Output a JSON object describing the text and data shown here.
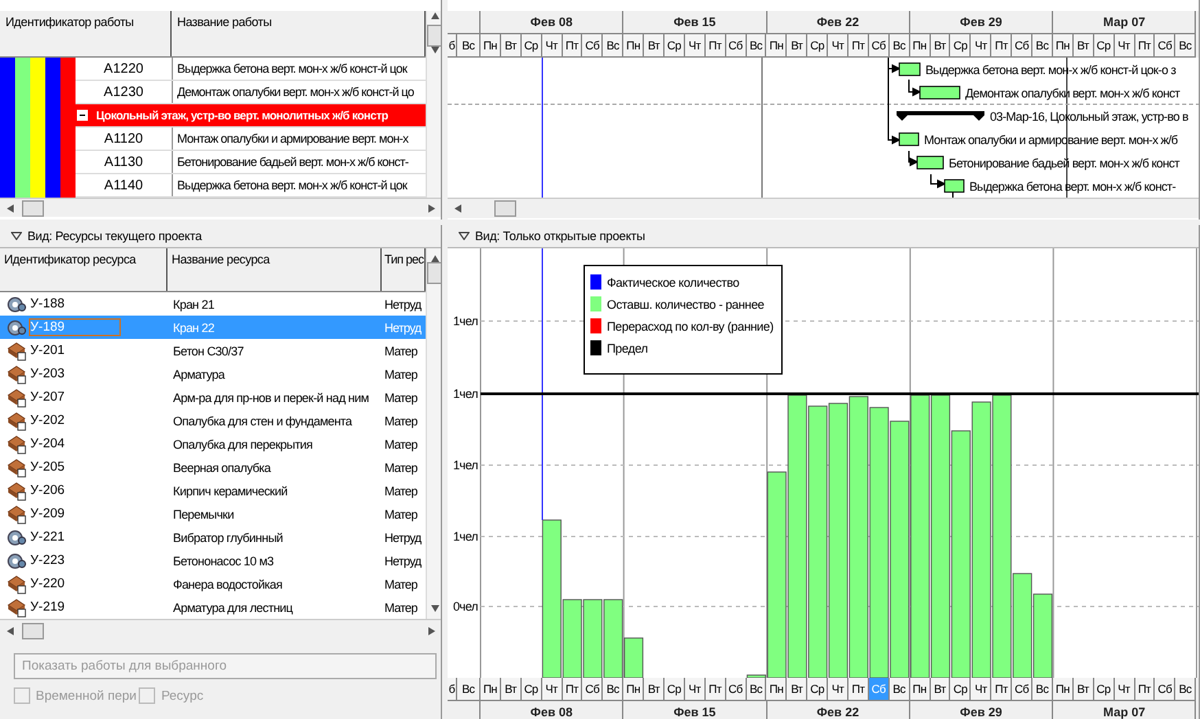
{
  "activities": {
    "columns": [
      "Идентификатор работы",
      "Название работы"
    ],
    "wbs_bands": [
      {
        "color": "#0000ff"
      },
      {
        "color": "#80ff80"
      },
      {
        "color": "#ffff00"
      },
      {
        "color": "#0000ff"
      },
      {
        "color": "#ff0000"
      }
    ],
    "rows": [
      {
        "kind": "activity",
        "id": "A1220",
        "name": "Выдержка бетона верт. мон-х ж/б конст-й цок"
      },
      {
        "kind": "activity",
        "id": "A1230",
        "name": "Демонтаж опалубки верт. мон-х ж/б конст-й цо"
      },
      {
        "kind": "wbs",
        "name": "Цокольный этаж, устр-во верт. монолитных ж/б констр",
        "expanded": true
      },
      {
        "kind": "activity",
        "id": "A1120",
        "name": "Монтаж опалубки и армирование верт. мон-х"
      },
      {
        "kind": "activity",
        "id": "A1130",
        "name": "Бетонирование бадьей верт. мон-х ж/б конст-"
      },
      {
        "kind": "activity",
        "id": "A1140",
        "name": "Выдержка бетона верт. мон-х ж/б конст-й цок"
      }
    ]
  },
  "gantt": {
    "months": [
      "Фев 08",
      "Фев 15",
      "Фев 22",
      "Фев 29",
      "Мар 07"
    ],
    "days": [
      "б",
      "Вс",
      "Пн",
      "Вт",
      "Ср",
      "Чт",
      "Пт",
      "Сб",
      "Вс",
      "Пн",
      "Вт",
      "Ср",
      "Чт",
      "Пт",
      "Сб",
      "Вс",
      "Пн",
      "Вт",
      "Ср",
      "Чт",
      "Пт",
      "Сб",
      "Вс",
      "Пн",
      "Вт",
      "Ср",
      "Чт",
      "Пт",
      "Сб",
      "Вс",
      "Пн",
      "Вт",
      "Ср",
      "Чт",
      "Пт",
      "Сб",
      "Вс"
    ],
    "bars": [
      {
        "kind": "activity",
        "label": "Выдержка бетона верт. мон-х ж/б конст-й цок-о з"
      },
      {
        "kind": "activity",
        "label": "Демонтаж опалубки верт. мон-х ж/б конст"
      },
      {
        "kind": "summary",
        "label": "03-Мар-16, Цокольный этаж, устр-во в"
      },
      {
        "kind": "activity",
        "label": "Монтаж опалубки и армирование верт. мон-х ж/б"
      },
      {
        "kind": "activity",
        "label": "Бетонирование бадьей верт. мон-х ж/б конст"
      },
      {
        "kind": "activity",
        "label": "Выдержка бетона верт. мон-х ж/б конст-"
      }
    ]
  },
  "resources": {
    "view": "Вид: Ресурсы текущего проекта",
    "columns": [
      "Идентификатор ресурса",
      "Название ресурса",
      "Тип рес"
    ],
    "rows": [
      {
        "kind": "nonlabor",
        "id": "У-188",
        "name": "Кран 21",
        "type": "Нетруд",
        "selected": false
      },
      {
        "kind": "nonlabor",
        "id": "У-189",
        "name": "Кран 22",
        "type": "Нетруд",
        "selected": true
      },
      {
        "kind": "material",
        "id": "У-201",
        "name": "Бетон С30/37",
        "type": "Матер",
        "selected": false
      },
      {
        "kind": "material",
        "id": "У-203",
        "name": "Арматура",
        "type": "Матер",
        "selected": false
      },
      {
        "kind": "material",
        "id": "У-207",
        "name": "Арм-ра для пр-нов и перек-й над ним",
        "type": "Матер",
        "selected": false
      },
      {
        "kind": "material",
        "id": "У-202",
        "name": "Опалубка для стен и фундамента",
        "type": "Матер",
        "selected": false
      },
      {
        "kind": "material",
        "id": "У-204",
        "name": "Опалубка для перекрытия",
        "type": "Матер",
        "selected": false
      },
      {
        "kind": "material",
        "id": "У-205",
        "name": "Веерная опалубка",
        "type": "Матер",
        "selected": false
      },
      {
        "kind": "material",
        "id": "У-206",
        "name": "Кирпич керамический",
        "type": "Матер",
        "selected": false
      },
      {
        "kind": "material",
        "id": "У-209",
        "name": "Перемычки",
        "type": "Матер",
        "selected": false
      },
      {
        "kind": "nonlabor",
        "id": "У-221",
        "name": "Вибратор глубинный",
        "type": "Нетруд",
        "selected": false
      },
      {
        "kind": "nonlabor",
        "id": "У-223",
        "name": "Бетононасос 10 м3",
        "type": "Нетруд",
        "selected": false
      },
      {
        "kind": "material",
        "id": "У-220",
        "name": "Фанера водостойкая",
        "type": "Матер",
        "selected": false
      },
      {
        "kind": "material",
        "id": "У-219",
        "name": "Арматура для лестниц",
        "type": "Матер",
        "selected": false
      }
    ],
    "show_button": {
      "label": "Показать работы для выбранного",
      "disabled": true
    },
    "checkboxes": [
      {
        "label": "Временной пери",
        "checked": false,
        "disabled": true
      },
      {
        "label": "Ресурс",
        "checked": false,
        "disabled": true
      }
    ]
  },
  "profile": {
    "view": "Вид: Только открытые проекты",
    "y_labels": [
      "1чел",
      "1чел",
      "1чел",
      "1чел",
      "0чел"
    ],
    "legend": [
      {
        "label": "Фактическое количество",
        "color": "#0000ff"
      },
      {
        "label": "Оставш. количество - раннее",
        "color": "#80ff80"
      },
      {
        "label": "Перерасход по кол-ву (ранние)",
        "color": "#ff0000"
      },
      {
        "label": "Предел",
        "color": "#000000"
      }
    ],
    "days": [
      {
        "label": "б",
        "selected": false
      },
      {
        "label": "Вс",
        "selected": false
      },
      {
        "label": "Пн",
        "selected": false
      },
      {
        "label": "Вт",
        "selected": false
      },
      {
        "label": "Ср",
        "selected": false
      },
      {
        "label": "Чт",
        "selected": false
      },
      {
        "label": "Пт",
        "selected": false
      },
      {
        "label": "Сб",
        "selected": false
      },
      {
        "label": "Вс",
        "selected": false
      },
      {
        "label": "Пн",
        "selected": false
      },
      {
        "label": "Вт",
        "selected": false
      },
      {
        "label": "Ср",
        "selected": false
      },
      {
        "label": "Чт",
        "selected": false
      },
      {
        "label": "Пт",
        "selected": false
      },
      {
        "label": "Сб",
        "selected": false
      },
      {
        "label": "Вс",
        "selected": false
      },
      {
        "label": "Пн",
        "selected": false
      },
      {
        "label": "Вт",
        "selected": false
      },
      {
        "label": "Ср",
        "selected": false
      },
      {
        "label": "Чт",
        "selected": false
      },
      {
        "label": "Пт",
        "selected": false
      },
      {
        "label": "Сб",
        "selected": true
      },
      {
        "label": "Вс",
        "selected": false
      },
      {
        "label": "Пн",
        "selected": false
      },
      {
        "label": "Вт",
        "selected": false
      },
      {
        "label": "Ср",
        "selected": false
      },
      {
        "label": "Чт",
        "selected": false
      },
      {
        "label": "Пт",
        "selected": false
      },
      {
        "label": "Сб",
        "selected": false
      },
      {
        "label": "Вс",
        "selected": false
      },
      {
        "label": "Пн",
        "selected": false
      },
      {
        "label": "Вт",
        "selected": false
      },
      {
        "label": "Ср",
        "selected": false
      },
      {
        "label": "Чт",
        "selected": false
      },
      {
        "label": "Пт",
        "selected": false
      },
      {
        "label": "Сб",
        "selected": false
      },
      {
        "label": "Вс",
        "selected": false
      }
    ],
    "months": [
      "Фев 08",
      "Фев 15",
      "Фев 22",
      "Фев 29",
      "Мар 07"
    ]
  }
}
